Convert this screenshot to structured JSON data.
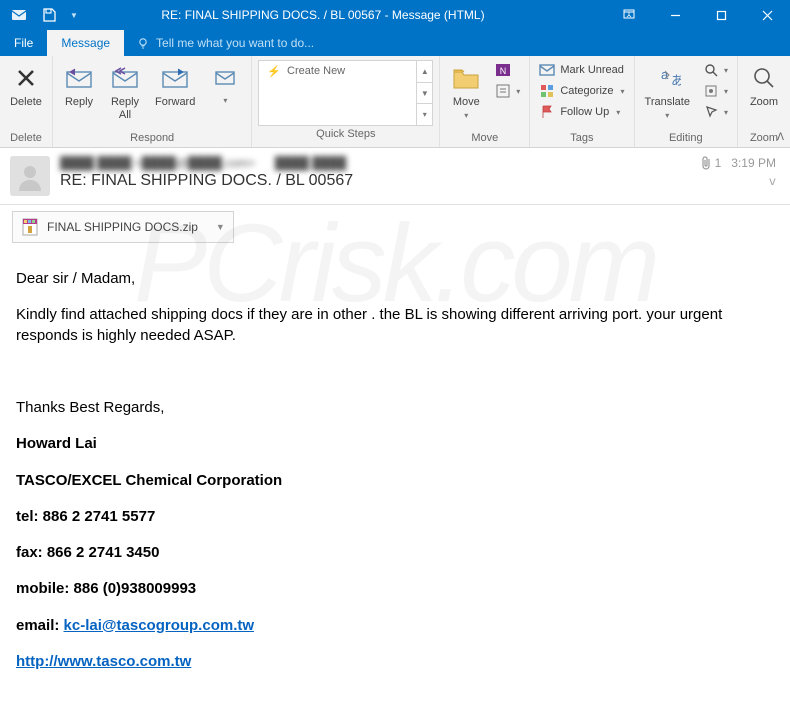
{
  "window": {
    "title": "RE: FINAL SHIPPING DOCS. / BL 00567 - Message (HTML)"
  },
  "tabs": {
    "file": "File",
    "message": "Message",
    "tellme": "Tell me what you want to do..."
  },
  "ribbon": {
    "delete": {
      "btn": "Delete",
      "group": "Delete"
    },
    "respond": {
      "reply": "Reply",
      "replyall": "Reply\nAll",
      "forward": "Forward",
      "group": "Respond"
    },
    "quicksteps": {
      "create": "Create New",
      "group": "Quick Steps"
    },
    "move": {
      "btn": "Move",
      "group": "Move"
    },
    "tags": {
      "unread": "Mark Unread",
      "categorize": "Categorize",
      "followup": "Follow Up",
      "group": "Tags"
    },
    "editing": {
      "translate": "Translate",
      "group": "Editing"
    },
    "zoom": {
      "btn": "Zoom",
      "group": "Zoom"
    }
  },
  "header": {
    "from_blurred": "████ ████ <████@████.com>",
    "to_blurred": "████ ████",
    "subject": "RE: FINAL SHIPPING DOCS. / BL 00567",
    "attcount": "1",
    "time": "3:19 PM"
  },
  "attachment": {
    "name": "FINAL SHIPPING DOCS.zip"
  },
  "body": {
    "greeting": "Dear sir / Madam,",
    "para1": "Kindly  find attached shipping docs if they are in other . the BL is showing different  arriving port. your urgent responds is highly needed ASAP.",
    "signoff": "Thanks Best Regards,",
    "name": "Howard Lai",
    "company": "TASCO/EXCEL Chemical Corporation",
    "tel_label": "tel: ",
    "tel": "886 2 2741 5577",
    "fax_label": "fax: ",
    "fax": "866 2 2741 3450",
    "mobile_label": "mobile: ",
    "mobile": "886 (0)938009993",
    "email_label": "email: ",
    "email": "kc-lai@tascogroup.com.tw",
    "url": "http://www.tasco.com.tw"
  }
}
